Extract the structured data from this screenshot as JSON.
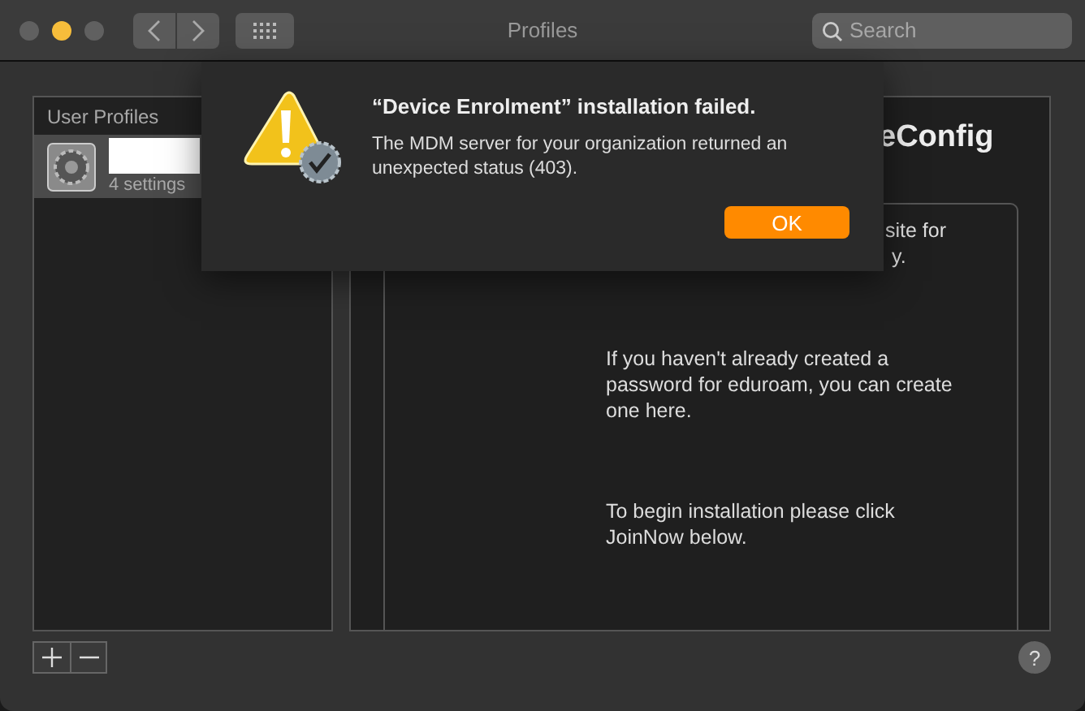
{
  "window": {
    "title": "Profiles"
  },
  "search": {
    "placeholder": "Search"
  },
  "sidebar": {
    "header": "User Profiles",
    "items": [
      {
        "subtitle": "4 settings",
        "selected": true
      }
    ]
  },
  "detail": {
    "title_fragment": "eConfig",
    "fragment_lines": [
      "site for",
      "y."
    ],
    "paragraphs": [
      "If you haven't already created a password for eduroam, you can create one here.",
      "To begin installation please click JoinNow below."
    ]
  },
  "help": "?",
  "dialog": {
    "title": "“Device Enrolment” installation failed.",
    "message": "The MDM server for your organization returned an unexpected status (403).",
    "button": "OK"
  }
}
